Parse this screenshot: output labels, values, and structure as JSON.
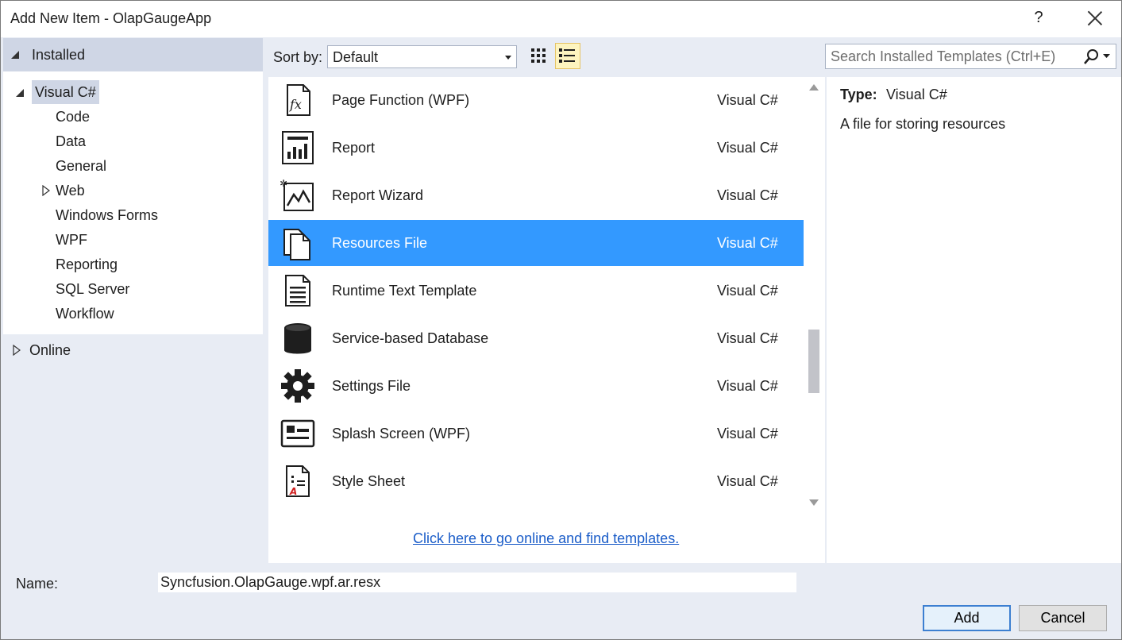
{
  "window": {
    "title": "Add New Item - OlapGaugeApp",
    "help": "?"
  },
  "left": {
    "header": "Installed",
    "root": "Visual C#",
    "children": [
      "Code",
      "Data",
      "General",
      "Web",
      "Windows Forms",
      "WPF",
      "Reporting",
      "SQL Server",
      "Workflow"
    ],
    "online": "Online"
  },
  "toolbar": {
    "sort_label": "Sort by:",
    "sort_value": "Default",
    "search_placeholder": "Search Installed Templates (Ctrl+E)"
  },
  "templates": [
    {
      "name": "Page Function (WPF)",
      "lang": "Visual C#",
      "icon": "function-icon"
    },
    {
      "name": "Report",
      "lang": "Visual C#",
      "icon": "report-icon"
    },
    {
      "name": "Report Wizard",
      "lang": "Visual C#",
      "icon": "report-wizard-icon"
    },
    {
      "name": "Resources File",
      "lang": "Visual C#",
      "icon": "resources-file-icon",
      "selected": true
    },
    {
      "name": "Runtime Text Template",
      "lang": "Visual C#",
      "icon": "text-template-icon"
    },
    {
      "name": "Service-based Database",
      "lang": "Visual C#",
      "icon": "database-icon"
    },
    {
      "name": "Settings File",
      "lang": "Visual C#",
      "icon": "gear-icon"
    },
    {
      "name": "Splash Screen (WPF)",
      "lang": "Visual C#",
      "icon": "splash-screen-icon"
    },
    {
      "name": "Style Sheet",
      "lang": "Visual C#",
      "icon": "style-sheet-icon"
    }
  ],
  "online_link": "Click here to go online and find templates.",
  "details": {
    "type_label": "Type:",
    "type_value": "Visual C#",
    "description": "A file for storing resources"
  },
  "bottom": {
    "name_label": "Name:",
    "name_value": "Syncfusion.OlapGauge.wpf.ar.resx",
    "add_label": "Add",
    "cancel_label": "Cancel"
  },
  "colors": {
    "selection": "#3399ff",
    "panel_bg": "#e8ecf4",
    "link": "#1a5cc8"
  }
}
